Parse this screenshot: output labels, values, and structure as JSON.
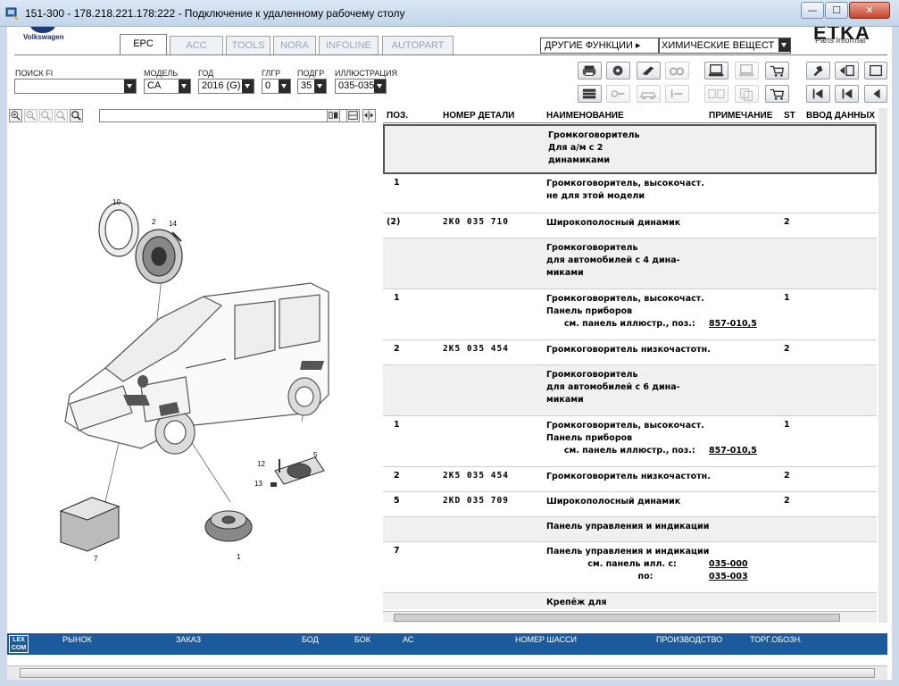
{
  "window": {
    "title": "151-300 - 178.218.221.178:222 - Подключение к удаленному рабочему столу",
    "min_glyph": "—",
    "max_glyph": "☐",
    "close_glyph": "✕"
  },
  "brand": {
    "label": "Volkswagen",
    "app_logo": "ETKA",
    "app_sub": "Parts Informat"
  },
  "tabs": [
    {
      "label": "EPC",
      "active": true
    },
    {
      "label": "ACC"
    },
    {
      "label": "TOOLS"
    },
    {
      "label": "NORA"
    },
    {
      "label": "INFOLINE"
    },
    {
      "label": "AUTOPART"
    }
  ],
  "more_functions": {
    "label": "ДРУГИЕ ФУНКЦИИ ▸",
    "select_value": "ХИМИЧЕСКИЕ ВЕЩЕСТ"
  },
  "filters": {
    "search": {
      "label": "ПОИСК FI",
      "value": ""
    },
    "model": {
      "label": "МОДЕЛЬ",
      "value": "CA"
    },
    "year": {
      "label": "ГОД",
      "value": "2016 (G)"
    },
    "hgr": {
      "label": "ГЛГР",
      "value": "0"
    },
    "ugr": {
      "label": "ПОДГР",
      "value": "35"
    },
    "illustration": {
      "label": "ИЛЛЮСТРАЦИЯ",
      "value": "035-035"
    }
  },
  "illustration": {
    "callouts": [
      "10",
      "2",
      "14",
      "5",
      "12",
      "13",
      "7",
      "1"
    ]
  },
  "table": {
    "headers": {
      "pos": "ПОЗ.",
      "part": "НОМЕР ДЕТАЛИ",
      "name": "НАИМЕНОВАНИЕ",
      "note": "ПРИМЕЧАНИЕ",
      "st": "ST",
      "input": "ВВОД ДАННЫХ"
    },
    "rows": [
      {
        "pos": "",
        "part": "",
        "name": "Громкоговоритель\nДля а/м с 2\nдинамиками",
        "note": "",
        "st": ""
      },
      {
        "pos": "1",
        "part": "",
        "name": "Громкоговоритель, высокочаст.\nне для этой модели",
        "note": "",
        "st": ""
      },
      {
        "pos": "(2)",
        "part": "2K0 035 710",
        "name": "Широкополосный динамик",
        "note": "",
        "st": "2"
      },
      {
        "pos": "",
        "part": "",
        "name": "Громкоговоритель\nдля автомобилей с 4 дина-\nмиками",
        "note": "",
        "st": ""
      },
      {
        "pos": "1",
        "part": "",
        "name": "Громкоговоритель, высокочаст.\nПанель приборов\n      см. панель иллюстр., поз.:",
        "note": "\n\n857-010,5",
        "st": "1"
      },
      {
        "pos": "2",
        "part": "2K5 035 454",
        "name": "Громкоговоритель низкочастотн.",
        "note": "",
        "st": "2"
      },
      {
        "pos": "",
        "part": "",
        "name": "Громкоговоритель\nдля автомобилей с 6 дина-\nмиками",
        "note": "",
        "st": ""
      },
      {
        "pos": "1",
        "part": "",
        "name": "Громкоговоритель, высокочаст.\nПанель приборов\n      см. панель иллюстр., поз.:",
        "note": "\n\n857-010,5",
        "st": "1"
      },
      {
        "pos": "2",
        "part": "2K5 035 454",
        "name": "Громкоговоритель низкочастотн.",
        "note": "",
        "st": "2"
      },
      {
        "pos": "5",
        "part": "2KD 035 709",
        "name": "Широкополосный динамик",
        "note": "",
        "st": "2"
      },
      {
        "pos": "",
        "part": "",
        "name": "Панель управления и индикации",
        "note": "",
        "st": ""
      },
      {
        "pos": "7",
        "part": "",
        "name": "Панель управления и индикации\n              см. панель илл. с:\n                               по:",
        "note": "\n035-000\n035-003",
        "st": ""
      },
      {
        "pos": "",
        "part": "",
        "name": "Крепёж для",
        "note": "",
        "st": ""
      }
    ]
  },
  "status_bar": {
    "logo": "LEX COM",
    "items": [
      "РЫНОК",
      "ЗАКАЗ",
      "БОД",
      "БОК",
      "АС",
      "НОМЕР ШАССИ",
      "ПРОИЗВОДСТВО",
      "ТОРГ.ОБОЗН."
    ]
  },
  "colors": {
    "status_bar": "#1b5a9c",
    "window_frame": "#cbd9ea",
    "close_button": "#c7432c"
  }
}
